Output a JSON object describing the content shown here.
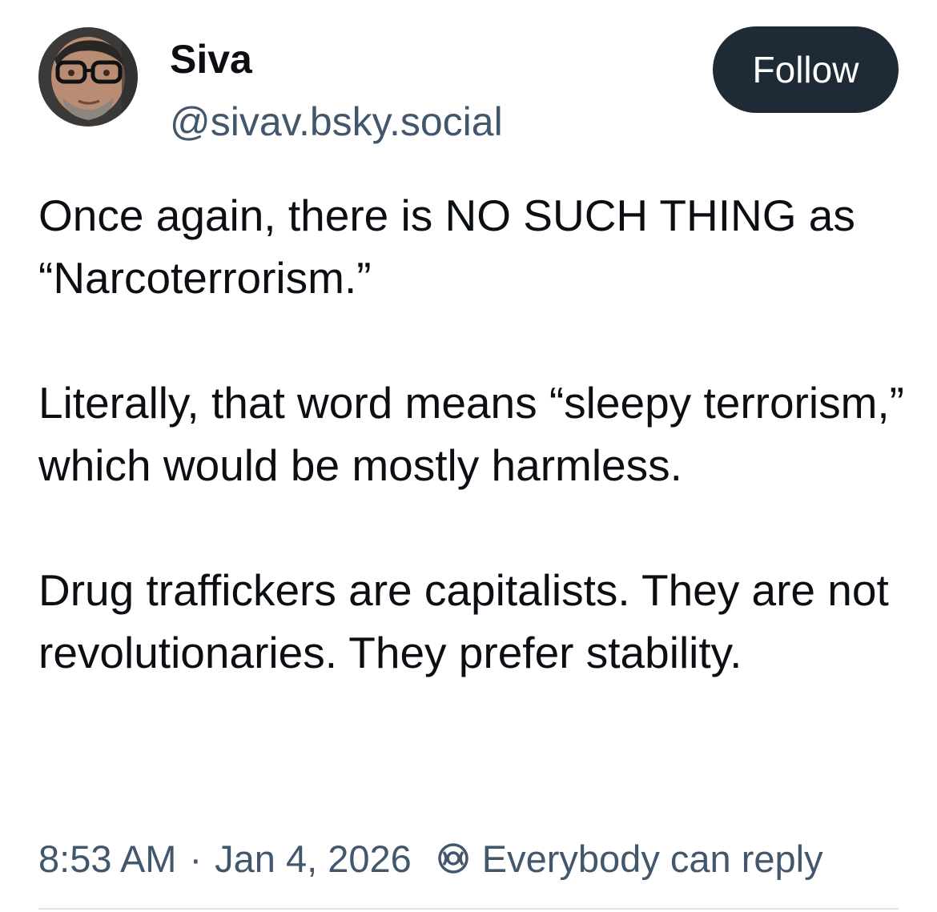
{
  "author": {
    "display_name": "Siva",
    "handle": "@sivav.bsky.social",
    "avatar_icon": "user-avatar-photo"
  },
  "follow_button": {
    "label": "Follow"
  },
  "post": {
    "paragraphs": [
      "Once again, there is NO SUCH THING as “Narcoterrorism.”",
      "Literally, that word means “sleepy terrorism,” which would be mostly harmless.",
      "Drug traffickers are capitalists. They are not revolutionaries. They prefer stability."
    ]
  },
  "meta": {
    "time": "8:53 AM",
    "separator": "·",
    "date": "Jan 4, 2026",
    "reply_icon": "reply-restriction-icon",
    "reply_setting": "Everybody can reply"
  },
  "colors": {
    "text": "#0b0f14",
    "secondary": "#42576c",
    "button_bg": "#1f2a37",
    "divider": "#dfe3e8"
  }
}
